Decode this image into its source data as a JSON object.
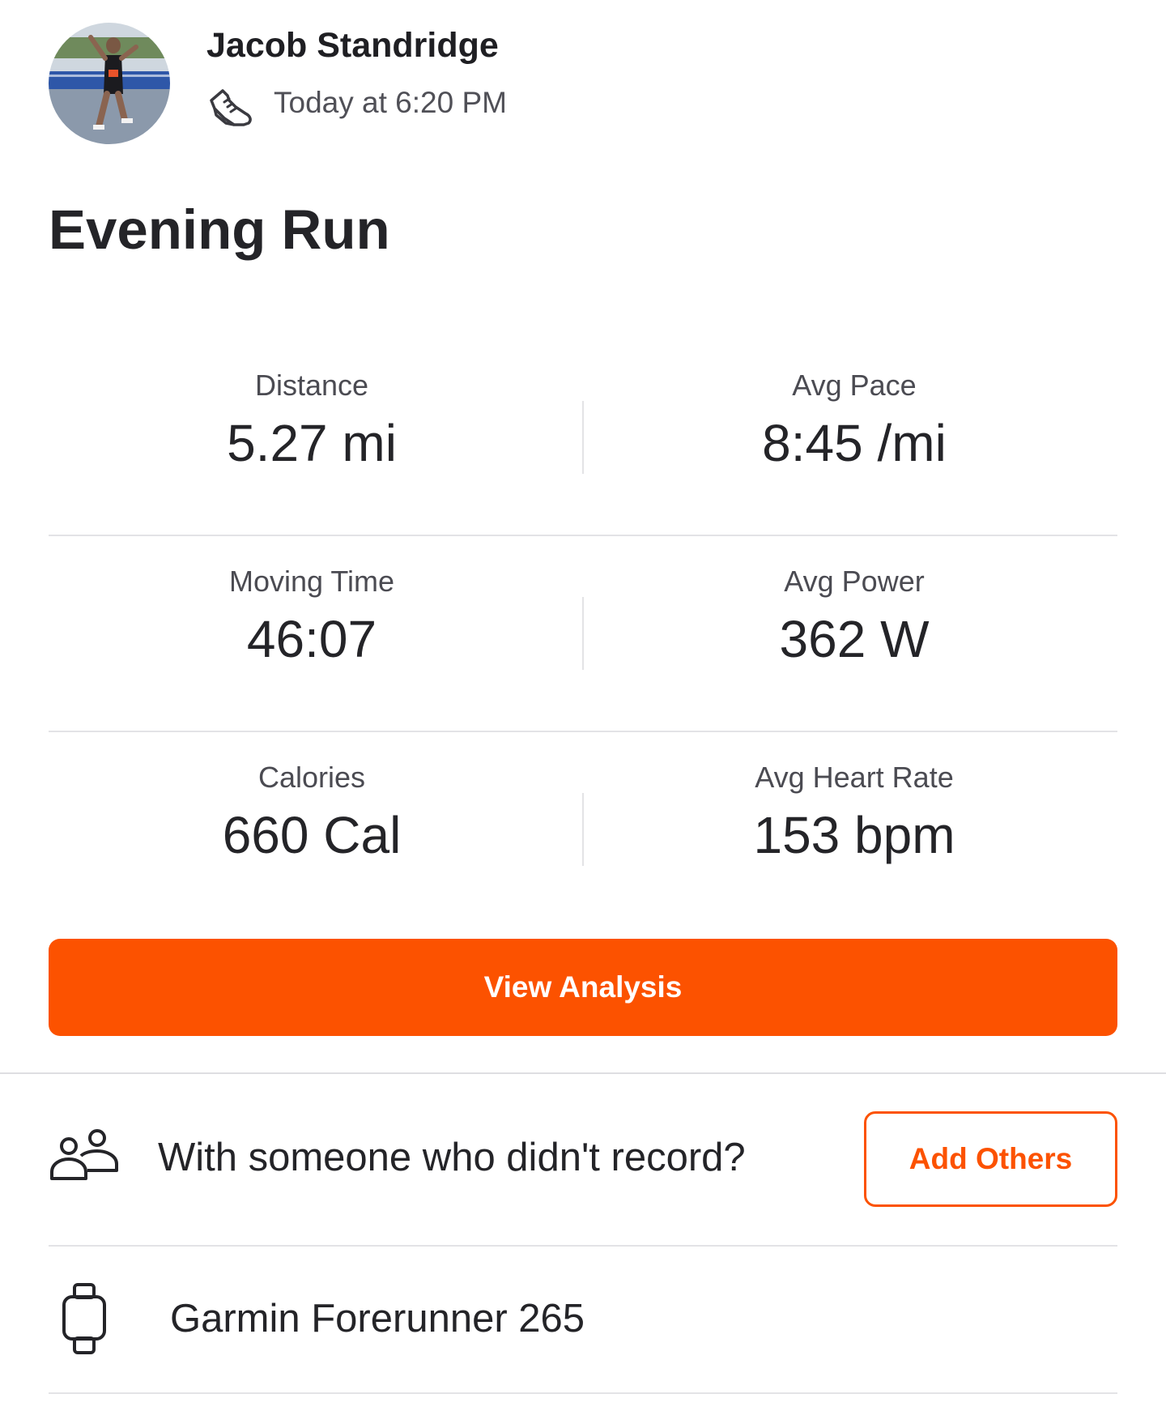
{
  "athlete": {
    "name": "Jacob Standridge",
    "timestamp": "Today at 6:20 PM",
    "activity_icon": "running-shoe-icon"
  },
  "activity": {
    "title": "Evening Run"
  },
  "stats": [
    {
      "label": "Distance",
      "value": "5.27 mi"
    },
    {
      "label": "Avg Pace",
      "value": "8:45 /mi"
    },
    {
      "label": "Moving Time",
      "value": "46:07"
    },
    {
      "label": "Avg Power",
      "value": "362 W"
    },
    {
      "label": "Calories",
      "value": "660 Cal"
    },
    {
      "label": "Avg Heart Rate",
      "value": "153 bpm"
    }
  ],
  "actions": {
    "view_analysis_label": "View Analysis",
    "add_others_label": "Add Others"
  },
  "group": {
    "prompt": "With someone who didn't record?",
    "icon": "people-icon"
  },
  "device": {
    "name": "Garmin Forerunner 265",
    "icon": "watch-icon"
  },
  "colors": {
    "accent": "#fc5200",
    "text": "#242428",
    "secondary_text": "#4b4b52",
    "divider": "#e3e3e6"
  }
}
